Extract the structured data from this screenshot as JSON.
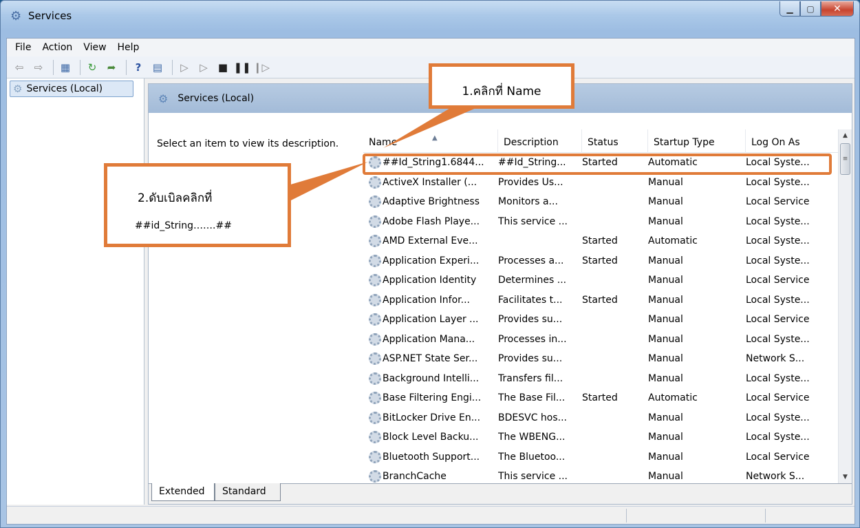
{
  "window": {
    "title": "Services"
  },
  "menu": [
    "File",
    "Action",
    "View",
    "Help"
  ],
  "tree": {
    "item": "Services (Local)"
  },
  "pane": {
    "header": "Services (Local)",
    "description": "Select an item to view its description."
  },
  "columns": [
    "Name",
    "Description",
    "Status",
    "Startup Type",
    "Log On As"
  ],
  "rows": [
    [
      "##Id_String1.6844...",
      "##Id_String...",
      "Started",
      "Automatic",
      "Local Syste..."
    ],
    [
      "ActiveX Installer (...",
      "Provides Us...",
      "",
      "Manual",
      "Local Syste..."
    ],
    [
      "Adaptive Brightness",
      "Monitors a...",
      "",
      "Manual",
      "Local Service"
    ],
    [
      "Adobe Flash Playe...",
      "This service ...",
      "",
      "Manual",
      "Local Syste..."
    ],
    [
      "AMD External Eve...",
      "",
      "Started",
      "Automatic",
      "Local Syste..."
    ],
    [
      "Application Experi...",
      "Processes a...",
      "Started",
      "Manual",
      "Local Syste..."
    ],
    [
      "Application Identity",
      "Determines ...",
      "",
      "Manual",
      "Local Service"
    ],
    [
      "Application Infor...",
      "Facilitates t...",
      "Started",
      "Manual",
      "Local Syste..."
    ],
    [
      "Application Layer ...",
      "Provides su...",
      "",
      "Manual",
      "Local Service"
    ],
    [
      "Application Mana...",
      "Processes in...",
      "",
      "Manual",
      "Local Syste..."
    ],
    [
      "ASP.NET State Ser...",
      "Provides su...",
      "",
      "Manual",
      "Network S..."
    ],
    [
      "Background Intelli...",
      "Transfers fil...",
      "",
      "Manual",
      "Local Syste..."
    ],
    [
      "Base Filtering Engi...",
      "The Base Fil...",
      "Started",
      "Automatic",
      "Local Service"
    ],
    [
      "BitLocker Drive En...",
      "BDESVC hos...",
      "",
      "Manual",
      "Local Syste..."
    ],
    [
      "Block Level Backu...",
      "The WBENG...",
      "",
      "Manual",
      "Local Syste..."
    ],
    [
      "Bluetooth Support...",
      "The Bluetoo...",
      "",
      "Manual",
      "Local Service"
    ],
    [
      "BranchCache",
      "This service ...",
      "",
      "Manual",
      "Network S..."
    ]
  ],
  "tabs": [
    "Extended",
    "Standard"
  ],
  "callouts": {
    "step1": "1.คลิกที่ Name",
    "step2_line1": "2.ดับเบิลคลิกที่",
    "step2_line2": "##id_String…….##"
  },
  "colors": {
    "accent": "#e07b39",
    "header_bg": "#a9c1dd"
  }
}
